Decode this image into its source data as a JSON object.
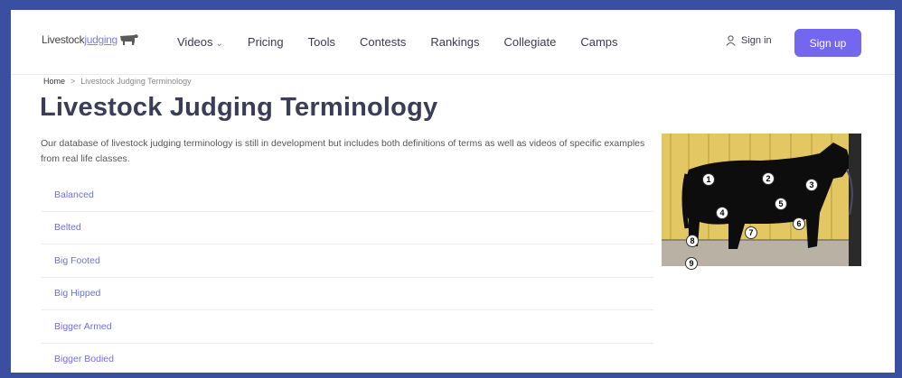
{
  "logo": {
    "text_main": "Livestock",
    "text_accent": "judging"
  },
  "nav": [
    {
      "label": "Videos",
      "has_dropdown": true
    },
    {
      "label": "Pricing"
    },
    {
      "label": "Tools"
    },
    {
      "label": "Contests"
    },
    {
      "label": "Rankings"
    },
    {
      "label": "Collegiate"
    },
    {
      "label": "Camps"
    }
  ],
  "auth": {
    "signin_label": "Sign in",
    "signup_label": "Sign up"
  },
  "breadcrumb": {
    "home": "Home",
    "separator": ">",
    "current": "Livestock Judging Terminology"
  },
  "page": {
    "title": "Livestock Judging Terminology",
    "description": "Our database of livestock judging terminology is still in development but includes both definitions of terms as well as videos of specific examples from real life classes."
  },
  "terms": [
    "Balanced",
    "Belted",
    "Big Footed",
    "Big Hipped",
    "Bigger Armed",
    "Bigger Bodied"
  ],
  "image": {
    "markers": [
      "1",
      "2",
      "3",
      "4",
      "5",
      "6",
      "7",
      "8",
      "9"
    ]
  },
  "colors": {
    "background_frame": "#3a4fa0",
    "accent": "#7367f0",
    "link": "#6f6ee0",
    "title": "#3a3d55"
  }
}
